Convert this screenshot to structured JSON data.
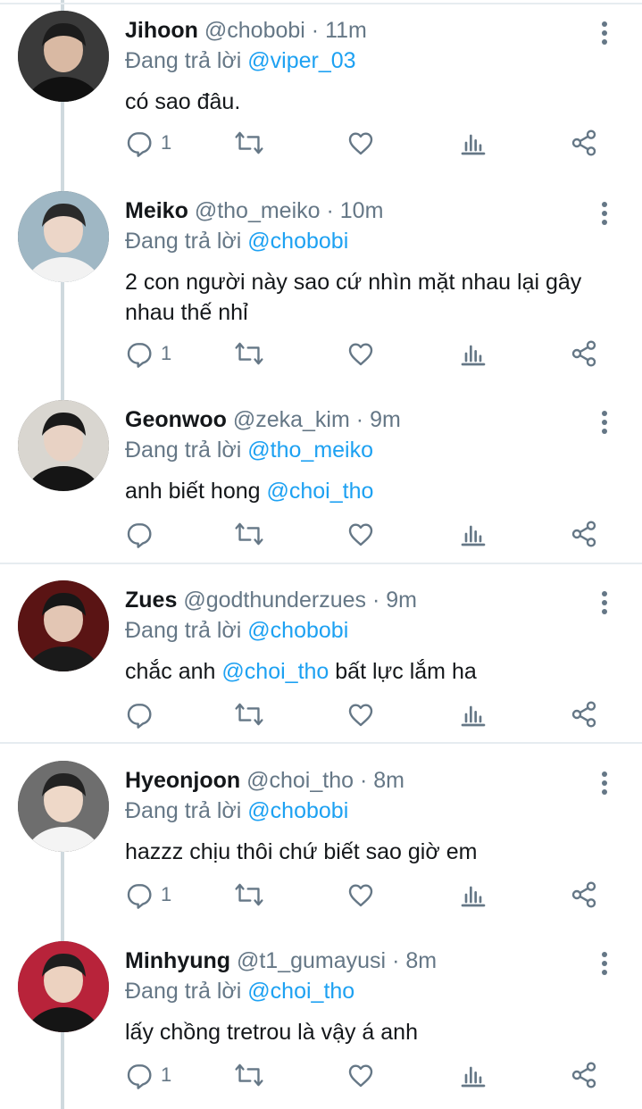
{
  "reply_prefix": "Đang trả lời",
  "tweets": [
    {
      "name": "Jihoon",
      "handle": "@chobobi",
      "dot": "·",
      "time": "11m",
      "reply_to": "@viper_03",
      "text": "có sao đâu.",
      "reply_count": "1",
      "avatar": {
        "bg": "#3a3a3a",
        "skin": "#d9b9a3",
        "hair": "#1c1c1c",
        "shirt": "#111111"
      }
    },
    {
      "name": "Meiko",
      "handle": "@tho_meiko",
      "dot": "·",
      "time": "10m",
      "reply_to": "@chobobi",
      "text": "2 con người này sao cứ nhìn mặt nhau lại gây nhau thế nhỉ",
      "reply_count": "1",
      "avatar": {
        "bg": "#9fb7c4",
        "skin": "#ecd6c8",
        "hair": "#2a2a2a",
        "shirt": "#f2f2f2"
      }
    },
    {
      "name": "Geonwoo",
      "handle": "@zeka_kim",
      "dot": "·",
      "time": "9m",
      "reply_to": "@tho_meiko",
      "text_before": "anh biết hong ",
      "text_mention": "@choi_tho",
      "text_after": "",
      "reply_count": "",
      "avatar": {
        "bg": "#d9d6d0",
        "skin": "#e8d2c4",
        "hair": "#1a1a1a",
        "shirt": "#151515"
      }
    },
    {
      "name": "Zues",
      "handle": "@godthunderzues",
      "dot": "·",
      "time": "9m",
      "reply_to": "@chobobi",
      "text_before": "chắc anh ",
      "text_mention": "@choi_tho",
      "text_after": " bất lực lắm ha",
      "reply_count": "",
      "avatar": {
        "bg": "#5a1414",
        "skin": "#e3c6b4",
        "hair": "#171717",
        "shirt": "#1a1a1a"
      }
    },
    {
      "name": "Hyeonjoon",
      "handle": "@choi_tho",
      "dot": "·",
      "time": "8m",
      "reply_to": "@chobobi",
      "text": "hazzz chịu thôi chứ biết sao giờ em",
      "reply_count": "1",
      "avatar": {
        "bg": "#6e6e6e",
        "skin": "#eed8c8",
        "hair": "#222222",
        "shirt": "#f4f4f4"
      }
    },
    {
      "name": "Minhyung",
      "handle": "@t1_gumayusi",
      "dot": "·",
      "time": "8m",
      "reply_to": "@choi_tho",
      "text": "lấy chồng tretrou là vậy á anh",
      "reply_count": "1",
      "avatar": {
        "bg": "#b8233a",
        "skin": "#ecd2c0",
        "hair": "#1e1e1e",
        "shirt": "#151515"
      }
    }
  ],
  "icons": {
    "reply": "reply-icon",
    "retweet": "retweet-icon",
    "like": "heart-icon",
    "analytics": "analytics-icon",
    "share": "share-icon",
    "more": "more-options-icon"
  },
  "colors": {
    "text": "#14171a",
    "secondary": "#657786",
    "link": "#1da1f2",
    "icon": "#657786",
    "thread_line": "#cfd9de",
    "divider": "#e6ecf0"
  }
}
